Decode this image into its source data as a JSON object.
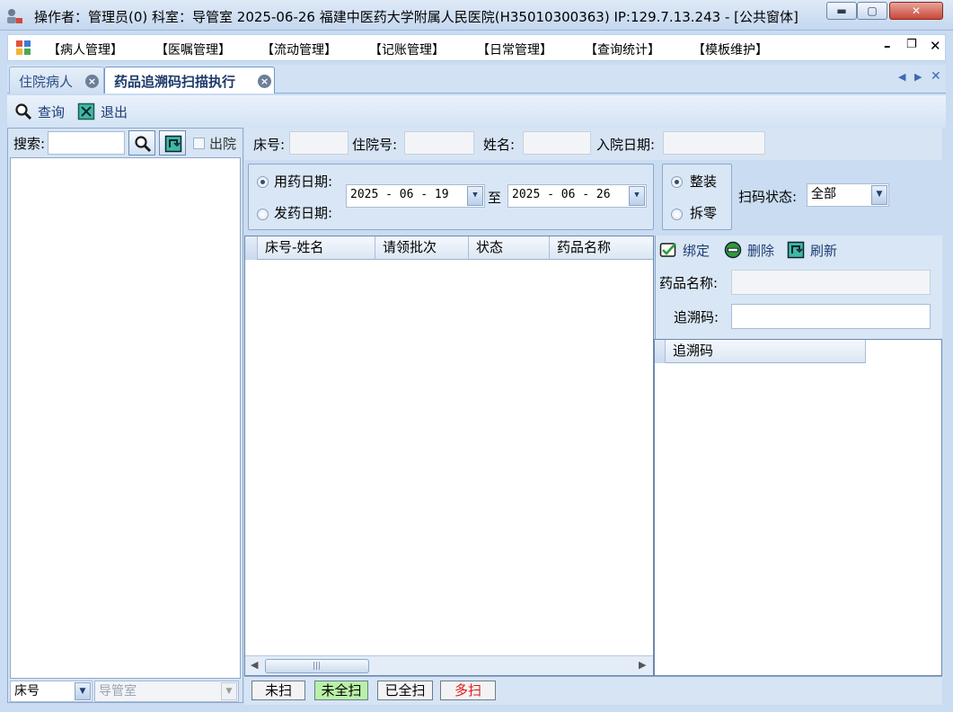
{
  "window": {
    "title": "操作者：管理员(0)  科室：导管室  2025-06-26  福建中医药大学附属人民医院(H35010300363) IP:129.7.13.243 - [公共窗体]",
    "controls": {
      "minimize": "▬",
      "maximize": "▢",
      "close": "✕"
    }
  },
  "menu": {
    "items": [
      "【病人管理】",
      "【医嘱管理】",
      "【流动管理】",
      "【记账管理】",
      "【日常管理】",
      "【查询统计】",
      "【模板维护】"
    ],
    "mdi": {
      "minimize": "–",
      "restore": "❐",
      "close": "✕"
    }
  },
  "tabs": [
    {
      "label": "住院病人"
    },
    {
      "label": "药品追溯码扫描执行"
    }
  ],
  "toolbar": {
    "query": "查询",
    "exit": "退出"
  },
  "left": {
    "search_label": "搜索:",
    "discharged_label": "出院",
    "sort_value": "床号",
    "dept_value": "导管室"
  },
  "patient": {
    "bed_label": "床号:",
    "inpatient_no_label": "住院号:",
    "name_label": "姓名:",
    "admit_date_label": "入院日期:"
  },
  "filter": {
    "use_date_label": "用药日期:",
    "dispense_date_label": "发药日期:",
    "date_from": "2025 - 06 - 19",
    "to_label": "至",
    "date_to": "2025 - 06 - 26",
    "whole_label": "整装",
    "split_label": "拆零",
    "scan_status_label": "扫码状态:",
    "scan_status_value": "全部"
  },
  "grid": {
    "columns": [
      "床号-姓名",
      "请领批次",
      "状态",
      "药品名称"
    ]
  },
  "right": {
    "bind": "绑定",
    "delete": "删除",
    "refresh": "刷新",
    "drug_name_label": "药品名称:",
    "trace_code_label": "追溯码:",
    "trace_grid_header": "追溯码"
  },
  "status_buttons": [
    {
      "label": "未扫",
      "color": "#000000",
      "bg": "#f3f3f3"
    },
    {
      "label": "未全扫",
      "color": "#000000",
      "bg": "#b8f0a8"
    },
    {
      "label": "已全扫",
      "color": "#000000",
      "bg": "#f3f3f3"
    },
    {
      "label": "多扫",
      "color": "#e01818",
      "bg": "#f3f3f3"
    }
  ]
}
